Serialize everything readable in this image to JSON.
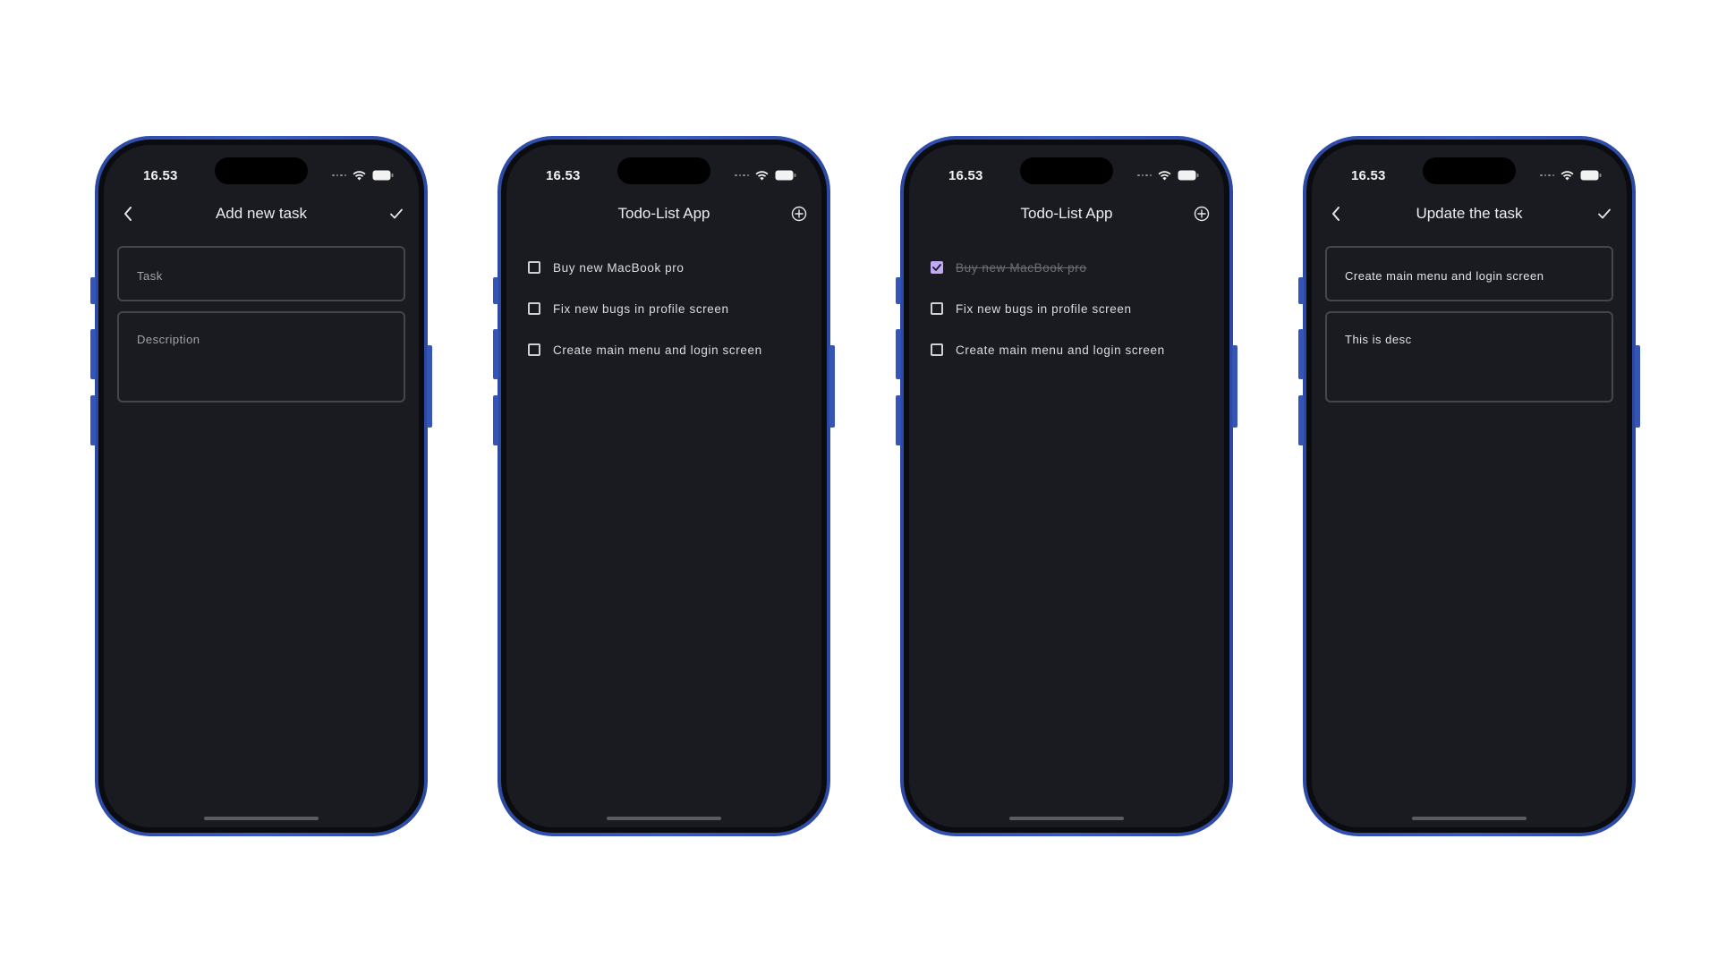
{
  "colors": {
    "frame": "#3a5cc6",
    "screen_bg": "#1a1b21",
    "accent": "#c2a8f5",
    "text": "#ececf0",
    "muted": "#a3a3ab",
    "field_border": "#44454d"
  },
  "status_bar": {
    "time": "16.53",
    "icons": [
      "signal-dots-icon",
      "wifi-icon",
      "battery-icon"
    ]
  },
  "screens": {
    "add": {
      "title": "Add new task",
      "left_icon": "chevron-left-icon",
      "right_icon": "checkmark-icon",
      "task_field": {
        "value": "",
        "placeholder": "Task"
      },
      "description_field": {
        "value": "",
        "placeholder": "Description"
      }
    },
    "list": {
      "title": "Todo-List App",
      "right_icon": "add-circle-icon",
      "items": [
        {
          "label": "Buy new MacBook pro",
          "checked": false
        },
        {
          "label": "Fix new bugs in profile screen",
          "checked": false
        },
        {
          "label": "Create main menu and login screen",
          "checked": false
        }
      ]
    },
    "list_checked": {
      "title": "Todo-List App",
      "right_icon": "add-circle-icon",
      "items": [
        {
          "label": "Buy new MacBook pro",
          "checked": true
        },
        {
          "label": "Fix new bugs in profile screen",
          "checked": false
        },
        {
          "label": "Create main menu and login screen",
          "checked": false
        }
      ]
    },
    "update": {
      "title": "Update the task",
      "left_icon": "chevron-left-icon",
      "right_icon": "checkmark-icon",
      "task_field": {
        "value": "Create main menu and login screen",
        "placeholder": "Task"
      },
      "description_field": {
        "value": "This is desc",
        "placeholder": "Description"
      }
    }
  }
}
